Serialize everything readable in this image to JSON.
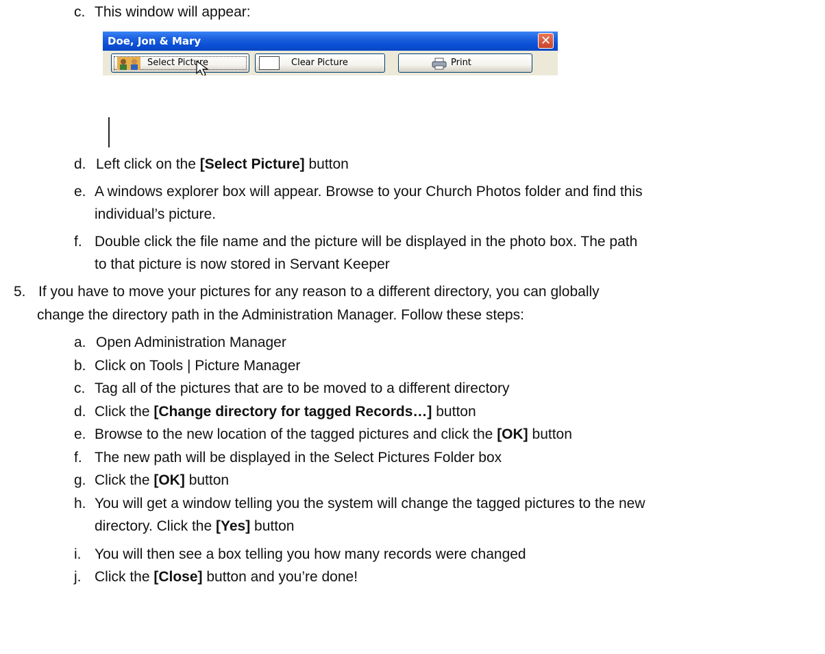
{
  "intro": {
    "marker": "c.",
    "text": "This window will appear:"
  },
  "window": {
    "title": "Doe, Jon & Mary",
    "close_glyph": "✕",
    "buttons": [
      {
        "label": "Select Picture",
        "icon": "people-icon"
      },
      {
        "label": "Clear Picture",
        "icon": "blank-picture-icon"
      },
      {
        "label": "Print",
        "icon": "printer-icon"
      }
    ]
  },
  "steps_a": [
    {
      "marker": "d.",
      "pre": "Left click on the ",
      "bold": "[Select Picture]",
      "post": " button"
    },
    {
      "marker": "e.",
      "lines": [
        "A windows explorer box will appear.  Browse to your Church Photos folder and find this",
        "individual’s picture."
      ]
    },
    {
      "marker": "f.",
      "lines": [
        "Double click the file name and the picture will be displayed in the photo box.  The path",
        "to that picture is now stored in Servant Keeper"
      ]
    }
  ],
  "item5": {
    "marker": "5.",
    "lines": [
      "If you have to move your pictures for any reason to a different directory, you can globally",
      "change the directory path in the Administration Manager.  Follow these steps:"
    ]
  },
  "steps_b": [
    {
      "marker": "a.",
      "pre": "Open  Administration Manager",
      "bold": "",
      "post": ""
    },
    {
      "marker": "b.",
      "pre": "Click on Tools | Picture Manager",
      "bold": "",
      "post": ""
    },
    {
      "marker": "c.",
      "pre": "Tag all of the pictures that are to be moved to a different directory",
      "bold": "",
      "post": ""
    },
    {
      "marker": "d.",
      "pre": "Click the ",
      "bold": "[Change directory for tagged Records…]",
      "post": " button"
    },
    {
      "marker": "e.",
      "pre": "Browse to the new location of the tagged pictures and click the ",
      "bold": "[OK]",
      "post": " button"
    },
    {
      "marker": "f.",
      "pre": "The new path will be displayed in the Select Pictures Folder box",
      "bold": "",
      "post": ""
    },
    {
      "marker": "g.",
      "pre": "Click the ",
      "bold": "[OK]",
      "post": " button"
    },
    {
      "marker": "h.",
      "line1": "You will get a window telling you the system will change the tagged pictures to the new",
      "pre": "directory.  Click the ",
      "bold": "[Yes]",
      "post": " button"
    },
    {
      "marker": "i.",
      "pre": "You will then see a box telling you how many records were changed",
      "bold": "",
      "post": ""
    },
    {
      "marker": "j.",
      "pre": "Click the ",
      "bold": "[Close]",
      "post": " button and  you’re done!"
    }
  ]
}
